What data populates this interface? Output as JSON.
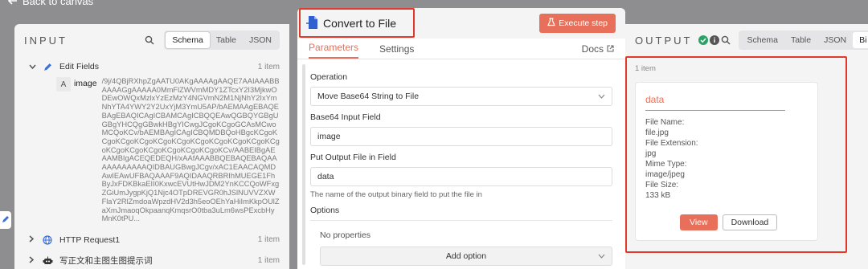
{
  "canvas": {
    "back_label": "Back to canvas"
  },
  "input_panel": {
    "title": "INPUT",
    "views": [
      "Schema",
      "Table",
      "JSON"
    ],
    "active_view": "Schema",
    "nodes": [
      {
        "label": "Edit Fields",
        "count": "1 item"
      },
      {
        "label": "HTTP Request1",
        "count": "1 item"
      },
      {
        "label": "写正文和主图生图提示词",
        "count": "1 item"
      }
    ],
    "field": {
      "type": "A",
      "name": "image",
      "value": "/9j/4QBjRXhpZgAATU0AKgAAAAgAAQE7AAIAAABBAAAAGgAAAAA0MmFlZWVmMDY1ZTcxY2I3MjkwODEwOWQxMzlxYzEzMzY4NGVmN2M1NjNhY2IxYmNhYTA4YWY2Y2UxYjM3YmU5AP/bAEMAAgEBAQEBAgEBAQICAgICBAMCAgICBQQEAwQGBQYGBgUGBgYHCQgGBwkHBgYICwgJCgoKCgoGCAsMCwoMCQoKCv/bAEMBAgICAgICBQMDBQoHBgcKCgoKCgoKCgoKCgoKCgoKCgoKCgoKCgoKCgoKCgoKCgoKCgoKCgoKCgoKCgoKCgoKCgoKCv/AABEIBgAEAAMBIgACEQEDEQH/xAAfAAABBQEBAQEBAQAAAAAAAAAAAQIDBAUGBwgJCgv/xAC1EAACAQMDAwIEAwUFBAQAAAF9AQIDAAQRBRIhMUEGE1FhByJxFDKBkaEII0KxwcEVUtHwJDM2YnKCCQoWFxgZGiUmJygpKjQ1Njc4OTpDREVGR0hJSlNUVVZXWFlaY2RlZmdoaWpzdHV2d3h5eoOEhYaHiImKkpOUlZaXmJmaoqOkpaanqKmqsrO0tba3uLm6wsPExcbHyMnK0tPU..."
    }
  },
  "node": {
    "title": "Convert to File",
    "execute_label": "Execute step",
    "tabs": [
      "Parameters",
      "Settings"
    ],
    "active_tab": "Parameters",
    "docs_label": "Docs",
    "operation_label": "Operation",
    "operation_value": "Move Base64 String to File",
    "base64_label": "Base64 Input Field",
    "base64_value": "image",
    "put_output_label": "Put Output File in Field",
    "put_output_value": "data",
    "put_output_hint": "The name of the output binary field to put the file in",
    "options_label": "Options",
    "no_properties": "No properties",
    "add_option_label": "Add option"
  },
  "output_panel": {
    "title": "OUTPUT",
    "views": [
      "Schema",
      "Table",
      "JSON",
      "Bi"
    ],
    "active_view": "Bi",
    "item_count": "1 item",
    "card": {
      "title": "data",
      "file_name_label": "File Name:",
      "file_name": "file.jpg",
      "file_ext_label": "File Extension:",
      "file_ext": "jpg",
      "mime_label": "Mime Type:",
      "mime": "image/jpeg",
      "size_label": "File Size:",
      "size": "133 kB",
      "view_label": "View",
      "download_label": "Download"
    }
  },
  "colors": {
    "accent": "#e8705a",
    "highlight": "#e23a2a",
    "success": "#29a366"
  }
}
